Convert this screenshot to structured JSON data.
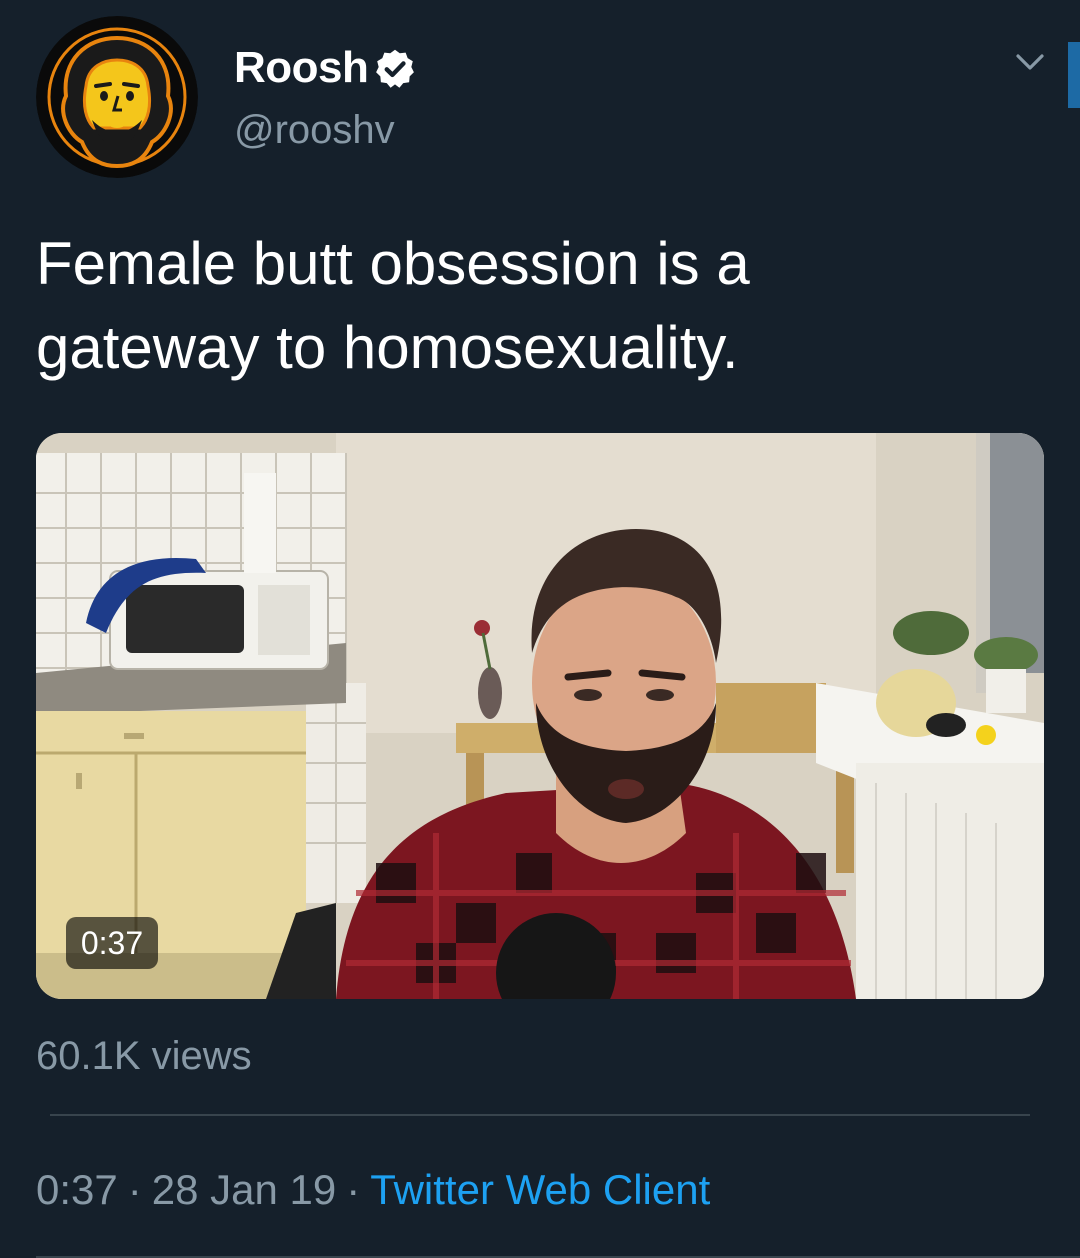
{
  "user": {
    "display_name": "Roosh",
    "handle": "@rooshv",
    "verified": true
  },
  "tweet": {
    "text_line1": "Female butt obsession is a",
    "text_line2": "gateway to homosexuality."
  },
  "media": {
    "duration": "0:37",
    "views": "60.1K views"
  },
  "meta": {
    "time": "0:37",
    "separator": "·",
    "date": "28 Jan 19",
    "source": "Twitter Web Client"
  },
  "icons": {
    "avatar": "cartoon-bearded-face-avatar",
    "verified": "verified-badge-icon",
    "menu": "chevron-down-icon"
  },
  "colors": {
    "background": "#15202b",
    "secondary_text": "#8899a6",
    "link": "#1da1f2",
    "divider": "#38444d",
    "scroll_indicator": "#1d6aa5"
  }
}
